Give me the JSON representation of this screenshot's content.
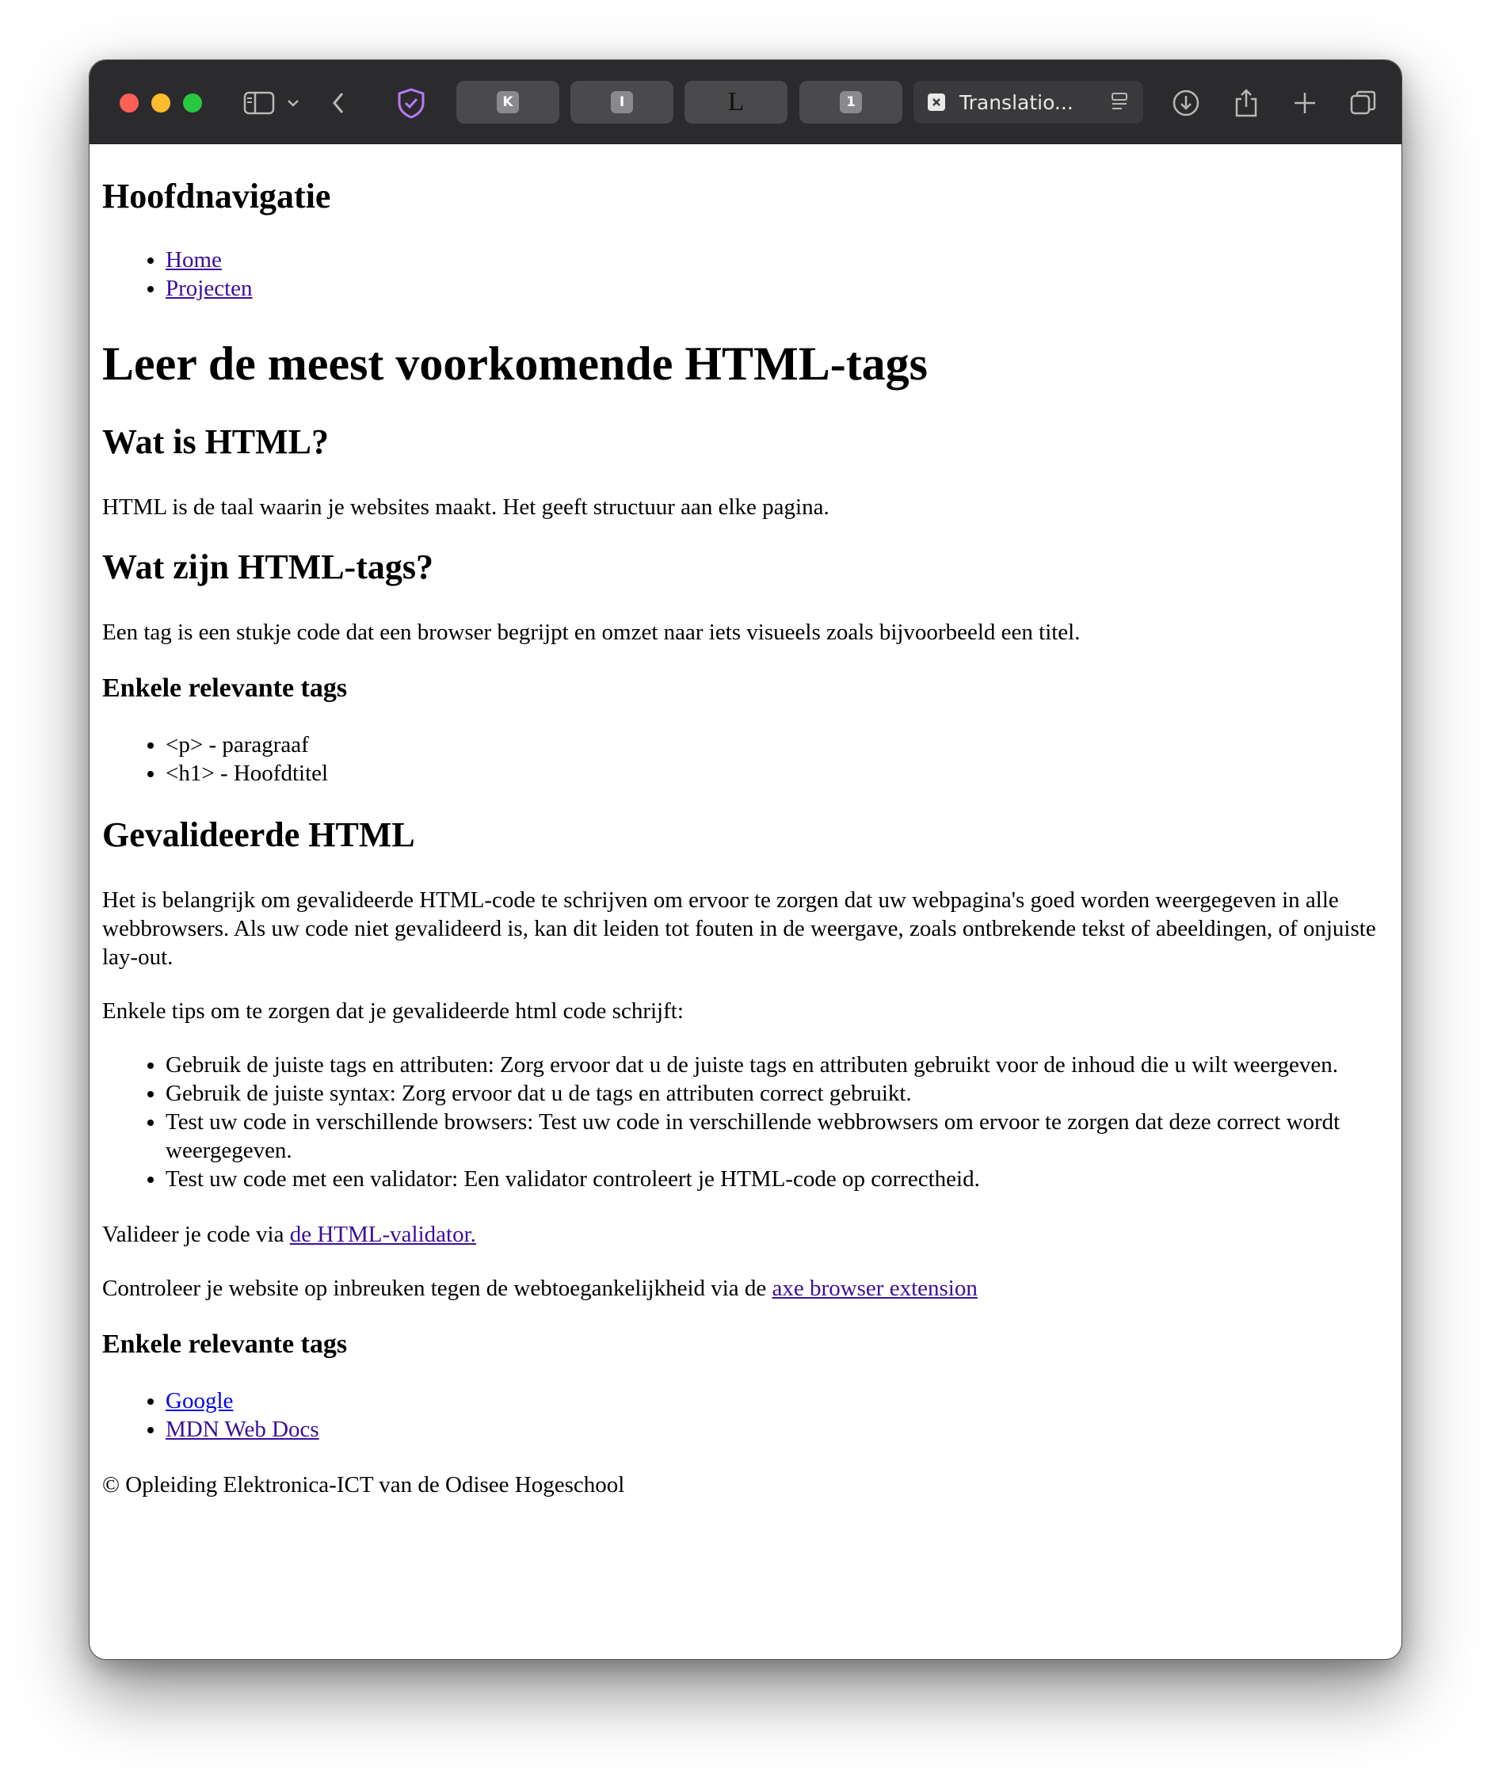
{
  "browser": {
    "tabs": [
      {
        "favicon": "K"
      },
      {
        "favicon": "I"
      },
      {
        "favicon": "L"
      },
      {
        "favicon": "1"
      }
    ],
    "active_tab": {
      "title": "Translatio..."
    },
    "icons": [
      "sidebar-icon",
      "chevron-down-icon",
      "back-icon",
      "shield-icon",
      "reader-icon",
      "download-icon",
      "share-icon",
      "plus-icon",
      "tabs-overview-icon"
    ],
    "colors": {
      "toolbar": "#2b2b2d",
      "close": "#fe5f57",
      "minimize": "#febc2e",
      "zoom": "#28c840",
      "shield": "#b57cf5",
      "visited_link": "#3b0f9c",
      "link": "#0000ee"
    }
  },
  "page": {
    "nav_heading": "Hoofdnavigatie",
    "nav_links": [
      "Home",
      "Projecten"
    ],
    "title": "Leer de meest voorkomende HTML-tags",
    "s1": {
      "heading": "Wat is HTML?",
      "text": "HTML is de taal waarin je websites maakt. Het geeft structuur aan elke pagina."
    },
    "s2": {
      "heading": "Wat zijn HTML-tags?",
      "text": "Een tag is een stukje code dat een browser begrijpt en omzet naar iets visueels zoals bijvoorbeeld een titel.",
      "subheading": "Enkele relevante tags",
      "tags": [
        "<p> - paragraaf",
        "<h1> - Hoofdtitel"
      ]
    },
    "s3": {
      "heading": "Gevalideerde HTML",
      "text": "Het is belangrijk om gevalideerde HTML-code te schrijven om ervoor te zorgen dat uw webpagina's goed worden weergegeven in alle webbrowsers. Als uw code niet gevalideerd is, kan dit leiden tot fouten in de weergave, zoals ontbrekende tekst of abeeldingen, of onjuiste lay-out.",
      "tips_intro": "Enkele tips om te zorgen dat je gevalideerde html code schrijft:",
      "tips": [
        "Gebruik de juiste tags en attributen: Zorg ervoor dat u de juiste tags en attributen gebruikt voor de inhoud die u wilt weergeven.",
        "Gebruik de juiste syntax: Zorg ervoor dat u de tags en attributen correct gebruikt.",
        "Test uw code in verschillende browsers: Test uw code in verschillende webbrowsers om ervoor te zorgen dat deze correct wordt weergegeven.",
        "Test uw code met een validator: Een validator controleert je HTML-code op correctheid."
      ],
      "validate_prefix": "Valideer je code via ",
      "validate_link": "de HTML-validator.",
      "axe_prefix": "Controleer je website op inbreuken tegen de webtoegankelijkheid via de ",
      "axe_link": "axe browser extension"
    },
    "s4": {
      "heading": "Enkele relevante tags",
      "links": [
        "Google",
        "MDN Web Docs"
      ]
    },
    "footer": "© Opleiding Elektronica-ICT van de Odisee Hogeschool"
  }
}
